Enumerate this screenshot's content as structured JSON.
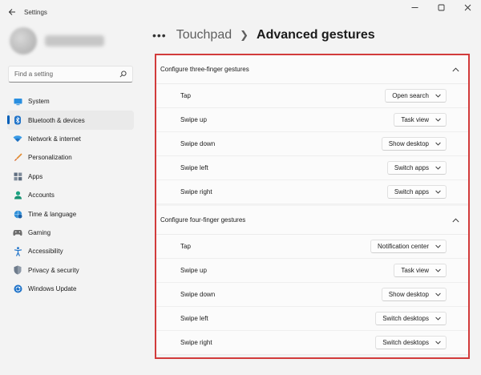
{
  "window": {
    "title": "Settings",
    "controls": [
      "minimize-icon",
      "maximize-icon",
      "close-icon"
    ]
  },
  "search": {
    "placeholder": "Find a setting",
    "icon": "search-icon"
  },
  "sidebar": {
    "items": [
      {
        "label": "System",
        "icon": "monitor-icon",
        "color": "#0078d4"
      },
      {
        "label": "Bluetooth & devices",
        "icon": "bluetooth-icon",
        "color": "#0078d4",
        "active": true
      },
      {
        "label": "Network & internet",
        "icon": "wifi-icon",
        "color": "#2f8fd8"
      },
      {
        "label": "Personalization",
        "icon": "brush-icon",
        "color": "#e28a2f"
      },
      {
        "label": "Apps",
        "icon": "apps-icon",
        "color": "#5f6e80"
      },
      {
        "label": "Accounts",
        "icon": "person-icon",
        "color": "#1da383"
      },
      {
        "label": "Time & language",
        "icon": "globe-clock-icon",
        "color": "#2f8fd8"
      },
      {
        "label": "Gaming",
        "icon": "gamepad-icon",
        "color": "#6b6b6b"
      },
      {
        "label": "Accessibility",
        "icon": "accessibility-icon",
        "color": "#1f73c9"
      },
      {
        "label": "Privacy & security",
        "icon": "shield-icon",
        "color": "#6e7b8b"
      },
      {
        "label": "Windows Update",
        "icon": "update-icon",
        "color": "#1f73c9"
      }
    ]
  },
  "breadcrumb": {
    "parent": "Touchpad",
    "current": "Advanced gestures"
  },
  "three_finger": {
    "title": "Configure three-finger gestures",
    "rows": [
      {
        "label": "Tap",
        "value": "Open search"
      },
      {
        "label": "Swipe up",
        "value": "Task view"
      },
      {
        "label": "Swipe down",
        "value": "Show desktop"
      },
      {
        "label": "Swipe left",
        "value": "Switch apps"
      },
      {
        "label": "Swipe right",
        "value": "Switch apps"
      }
    ]
  },
  "four_finger": {
    "title": "Configure four-finger gestures",
    "rows": [
      {
        "label": "Tap",
        "value": "Notification center"
      },
      {
        "label": "Swipe up",
        "value": "Task view"
      },
      {
        "label": "Swipe down",
        "value": "Show desktop"
      },
      {
        "label": "Swipe left",
        "value": "Switch desktops"
      },
      {
        "label": "Swipe right",
        "value": "Switch desktops"
      }
    ]
  },
  "colors": {
    "accent": "#005fb8",
    "highlight_border": "#d23b3b"
  }
}
